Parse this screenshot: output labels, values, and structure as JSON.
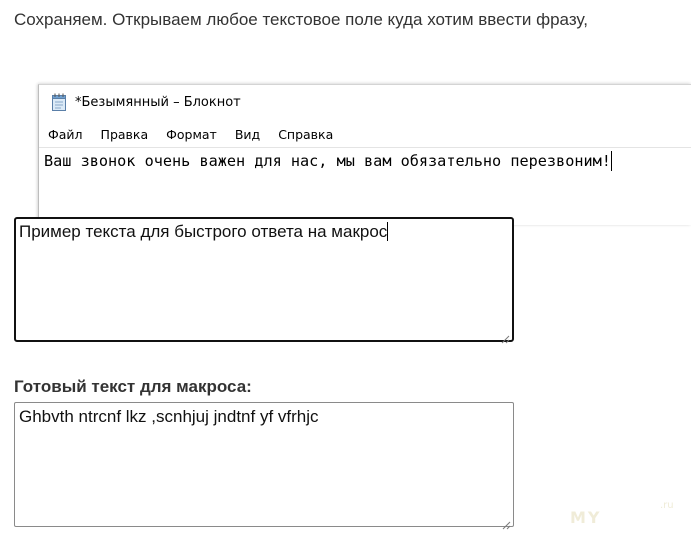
{
  "intro_text": "Сохраняем. Открываем любое текстовое поле куда хотим ввести фразу,",
  "notepad": {
    "title": "*Безымянный – Блокнот",
    "menu": [
      "Файл",
      "Правка",
      "Формат",
      "Вид",
      "Справка"
    ],
    "text": "Ваш звонок очень важен для нас, мы вам обязательно перезвоним!"
  },
  "macro_field": {
    "value": "Пример текста для быстрого ответа на макрос"
  },
  "result": {
    "label": "Готовый текст для макроса:",
    "value": "Ghbvth ntrcnf lkz ,scnhjuj jndtnf yf vfrhjc"
  },
  "watermark": {
    "text": "MY",
    "suffix": ".ru"
  }
}
